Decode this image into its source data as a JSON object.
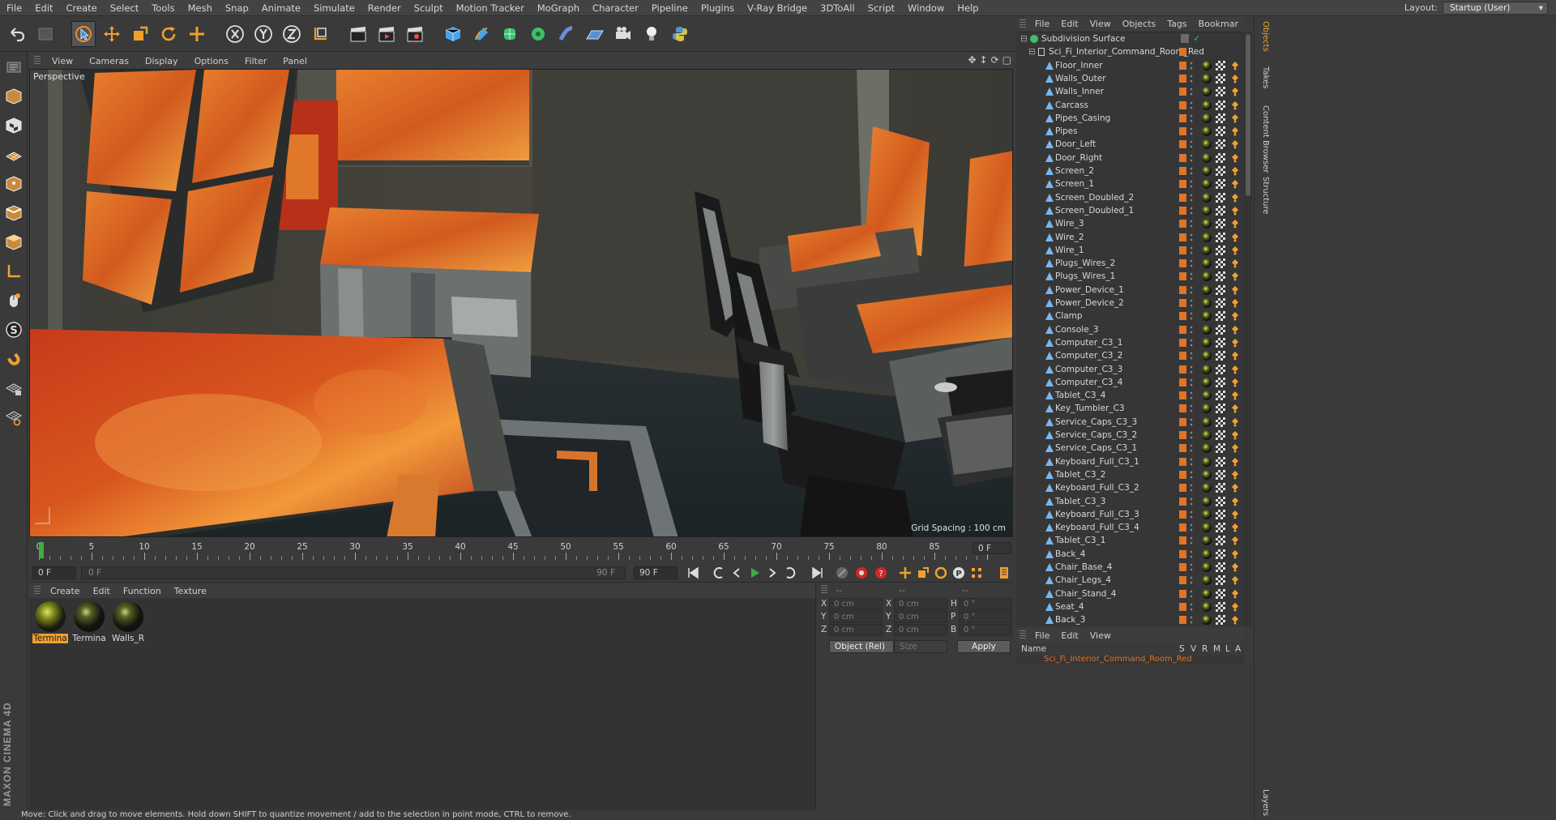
{
  "menubar": {
    "items": [
      "File",
      "Edit",
      "Create",
      "Select",
      "Tools",
      "Mesh",
      "Snap",
      "Animate",
      "Simulate",
      "Render",
      "Sculpt",
      "Motion Tracker",
      "MoGraph",
      "Character",
      "Pipeline",
      "Plugins",
      "V-Ray Bridge",
      "3DToAll",
      "Script",
      "Window",
      "Help"
    ],
    "layout_label": "Layout:",
    "layout_value": "Startup (User)"
  },
  "viewport": {
    "menu": [
      "View",
      "Cameras",
      "Display",
      "Options",
      "Filter",
      "Panel"
    ],
    "label": "Perspective",
    "grid_spacing": "Grid Spacing : 100 cm"
  },
  "timeline": {
    "ticks": [
      "0",
      "5",
      "10",
      "15",
      "20",
      "25",
      "30",
      "35",
      "40",
      "45",
      "50",
      "55",
      "60",
      "65",
      "70",
      "75",
      "80",
      "85",
      "90"
    ],
    "current_frame": "0 F",
    "end_frame_field": "0 F"
  },
  "transport": {
    "start_field": "0 F",
    "range_start": "0 F",
    "range_end": "90 F",
    "end_field": "90 F"
  },
  "materials": {
    "menu": [
      "Create",
      "Edit",
      "Function",
      "Texture"
    ],
    "items": [
      {
        "label": "Termina",
        "selected": true
      },
      {
        "label": "Termina",
        "selected": false
      },
      {
        "label": "Walls_R",
        "selected": false
      }
    ]
  },
  "coordinates": {
    "header_a": "--",
    "header_b": "--",
    "header_c": "--",
    "rows": [
      {
        "l1": "X",
        "v1": "0 cm",
        "l2": "X",
        "v2": "0 cm",
        "l3": "H",
        "v3": "0 °"
      },
      {
        "l1": "Y",
        "v1": "0 cm",
        "l2": "Y",
        "v2": "0 cm",
        "l3": "P",
        "v3": "0 °"
      },
      {
        "l1": "Z",
        "v1": "0 cm",
        "l2": "Z",
        "v2": "0 cm",
        "l3": "B",
        "v3": "0 °"
      }
    ],
    "mode": "Object (Rel)",
    "size": "Size",
    "apply": "Apply"
  },
  "status": "Move: Click and drag to move elements. Hold down SHIFT to quantize movement / add to the selection in point mode, CTRL to remove.",
  "object_manager": {
    "menu": [
      "File",
      "Edit",
      "View",
      "Objects",
      "Tags",
      "Bookmar"
    ],
    "root": "Subdivision Surface",
    "group": "Sci_Fi_Interior_Command_Room_Red",
    "objects": [
      "Floor_Inner",
      "Walls_Outer",
      "Walls_Inner",
      "Carcass",
      "Pipes_Casing",
      "Pipes",
      "Door_Left",
      "Door_Right",
      "Screen_2",
      "Screen_1",
      "Screen_Doubled_2",
      "Screen_Doubled_1",
      "Wire_3",
      "Wire_2",
      "Wire_1",
      "Plugs_Wires_2",
      "Plugs_Wires_1",
      "Power_Device_1",
      "Power_Device_2",
      "Clamp",
      "Console_3",
      "Computer_C3_1",
      "Computer_C3_2",
      "Computer_C3_3",
      "Computer_C3_4",
      "Tablet_C3_4",
      "Key_Tumbler_C3",
      "Service_Caps_C3_3",
      "Service_Caps_C3_2",
      "Service_Caps_C3_1",
      "Keyboard_Full_C3_1",
      "Tablet_C3_2",
      "Keyboard_Full_C3_2",
      "Tablet_C3_3",
      "Keyboard_Full_C3_3",
      "Keyboard_Full_C3_4",
      "Tablet_C3_1",
      "Back_4",
      "Chair_Base_4",
      "Chair_Legs_4",
      "Chair_Stand_4",
      "Seat_4",
      "Back_3"
    ]
  },
  "layer_manager": {
    "menu": [
      "File",
      "Edit",
      "View"
    ],
    "col_name": "Name",
    "cols": [
      "S",
      "V",
      "R",
      "M",
      "L",
      "A"
    ],
    "row": "Sci_Fi_Interior_Command_Room_Red"
  },
  "right_tabs": [
    "Objects",
    "Takes",
    "Content Browser",
    "Structure",
    "Layers"
  ],
  "colors": {
    "accent": "#f0a030",
    "tag_orange": "#e07428",
    "play_green": "#3fae3f"
  }
}
